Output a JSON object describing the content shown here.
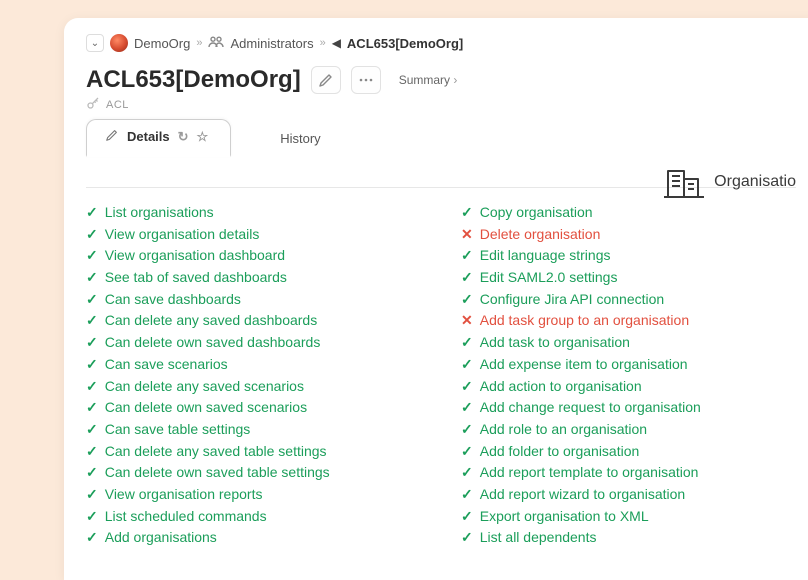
{
  "breadcrumb": {
    "org": "DemoOrg",
    "group": "Administrators",
    "current": "ACL653[DemoOrg]"
  },
  "title": "ACL653[DemoOrg]",
  "summary_link": "Summary",
  "subtype": "ACL",
  "tabs": {
    "details": "Details",
    "history": "History"
  },
  "section_label": "Organisatio",
  "icons": {
    "pencil": "✎",
    "more": "⋯",
    "refresh": "↻",
    "star": "☆",
    "key": "🗝",
    "chevron_down": "⌄",
    "chevron_right": "»",
    "back": "◀"
  },
  "permissions": {
    "left": [
      {
        "ok": true,
        "label": "List organisations"
      },
      {
        "ok": true,
        "label": "View organisation details"
      },
      {
        "ok": true,
        "label": "View organisation dashboard"
      },
      {
        "ok": true,
        "label": "See tab of saved dashboards"
      },
      {
        "ok": true,
        "label": "Can save dashboards"
      },
      {
        "ok": true,
        "label": "Can delete any saved dashboards"
      },
      {
        "ok": true,
        "label": "Can delete own saved dashboards"
      },
      {
        "ok": true,
        "label": "Can save scenarios"
      },
      {
        "ok": true,
        "label": "Can delete any saved scenarios"
      },
      {
        "ok": true,
        "label": "Can delete own saved scenarios"
      },
      {
        "ok": true,
        "label": "Can save table settings"
      },
      {
        "ok": true,
        "label": "Can delete any saved table settings"
      },
      {
        "ok": true,
        "label": "Can delete own saved table settings"
      },
      {
        "ok": true,
        "label": "View organisation reports"
      },
      {
        "ok": true,
        "label": "List scheduled commands"
      },
      {
        "ok": true,
        "label": "Add organisations"
      }
    ],
    "right": [
      {
        "ok": true,
        "label": "Copy organisation"
      },
      {
        "ok": false,
        "label": "Delete organisation"
      },
      {
        "ok": true,
        "label": "Edit language strings"
      },
      {
        "ok": true,
        "label": "Edit SAML2.0 settings"
      },
      {
        "ok": true,
        "label": "Configure Jira API connection"
      },
      {
        "ok": false,
        "label": "Add task group to an organisation"
      },
      {
        "ok": true,
        "label": "Add task to organisation"
      },
      {
        "ok": true,
        "label": "Add expense item to organisation"
      },
      {
        "ok": true,
        "label": "Add action to organisation"
      },
      {
        "ok": true,
        "label": "Add change request to organisation"
      },
      {
        "ok": true,
        "label": "Add role to an organisation"
      },
      {
        "ok": true,
        "label": "Add folder to organisation"
      },
      {
        "ok": true,
        "label": "Add report template to organisation"
      },
      {
        "ok": true,
        "label": "Add report wizard to organisation"
      },
      {
        "ok": true,
        "label": "Export organisation to XML"
      },
      {
        "ok": true,
        "label": "List all dependents"
      }
    ]
  }
}
